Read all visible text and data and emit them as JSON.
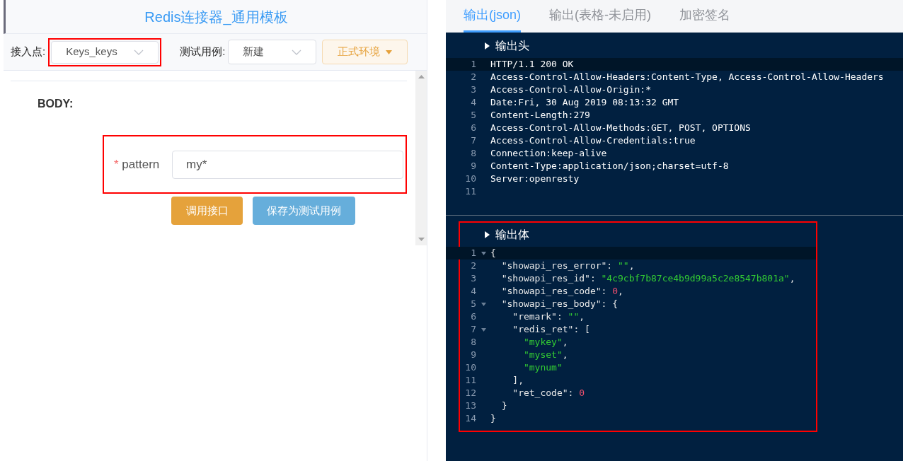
{
  "left": {
    "title": "Redis连接器_通用模板",
    "toolbar": {
      "endpoint_label": "接入点:",
      "endpoint_value": "Keys_keys",
      "testcase_label": "测试用例:",
      "testcase_value": "新建",
      "env_button": "正式环境"
    },
    "body_label": "BODY:",
    "field": {
      "required_mark": "*",
      "label": "pattern",
      "value": "my*"
    },
    "buttons": [
      {
        "label": "调用接口",
        "kind": "primary"
      },
      {
        "label": "保存为测试用例",
        "kind": "secondary"
      }
    ]
  },
  "right": {
    "tabs": [
      {
        "label": "输出(json)",
        "selected": true
      },
      {
        "label": "输出(表格-未启用)",
        "selected": false
      },
      {
        "label": "加密签名",
        "selected": false
      }
    ],
    "sections": [
      {
        "title": "输出头",
        "lines": [
          {
            "number": "1",
            "active": true,
            "tokens": [
              {
                "kind": "plain",
                "text": "HTTP/1.1 200 OK"
              }
            ]
          },
          {
            "number": "2",
            "tokens": [
              {
                "kind": "plain",
                "text": "Access-Control-Allow-Headers:Content-Type, Access-Control-Allow-Headers"
              }
            ]
          },
          {
            "number": "3",
            "tokens": [
              {
                "kind": "plain",
                "text": "Access-Control-Allow-Origin:*"
              }
            ]
          },
          {
            "number": "4",
            "tokens": [
              {
                "kind": "plain",
                "text": "Date:Fri, 30 Aug 2019 08:13:32 GMT"
              }
            ]
          },
          {
            "number": "5",
            "tokens": [
              {
                "kind": "plain",
                "text": "Content-Length:279"
              }
            ]
          },
          {
            "number": "6",
            "tokens": [
              {
                "kind": "plain",
                "text": "Access-Control-Allow-Methods:GET, POST, OPTIONS"
              }
            ]
          },
          {
            "number": "7",
            "tokens": [
              {
                "kind": "plain",
                "text": "Access-Control-Allow-Credentials:true"
              }
            ]
          },
          {
            "number": "8",
            "tokens": [
              {
                "kind": "plain",
                "text": "Connection:keep-alive"
              }
            ]
          },
          {
            "number": "9",
            "tokens": [
              {
                "kind": "plain",
                "text": "Content-Type:application/json;charset=utf-8"
              }
            ]
          },
          {
            "number": "10",
            "tokens": [
              {
                "kind": "plain",
                "text": "Server:openresty"
              }
            ]
          },
          {
            "number": "11"
          }
        ]
      },
      {
        "title": "输出体",
        "highlighted": true,
        "lines": [
          {
            "number": "1",
            "active": true,
            "fold": true,
            "tokens": [
              {
                "kind": "punct",
                "text": "{"
              }
            ]
          },
          {
            "number": "2",
            "tokens": [
              {
                "kind": "key",
                "text": "  \"showapi_res_error\": "
              },
              {
                "kind": "string",
                "text": "\"\""
              },
              {
                "kind": "punct",
                "text": ","
              }
            ]
          },
          {
            "number": "3",
            "tokens": [
              {
                "kind": "key",
                "text": "  \"showapi_res_id\": "
              },
              {
                "kind": "string",
                "text": "\"4c9cbf7b87ce4b9d99a5c2e8547b801a\""
              },
              {
                "kind": "punct",
                "text": ","
              }
            ]
          },
          {
            "number": "4",
            "tokens": [
              {
                "kind": "key",
                "text": "  \"showapi_res_code\": "
              },
              {
                "kind": "number",
                "text": "0"
              },
              {
                "kind": "punct",
                "text": ","
              }
            ]
          },
          {
            "number": "5",
            "fold": true,
            "tokens": [
              {
                "kind": "key",
                "text": "  \"showapi_res_body\": "
              },
              {
                "kind": "punct",
                "text": "{"
              }
            ]
          },
          {
            "number": "6",
            "tokens": [
              {
                "kind": "key",
                "text": "    \"remark\": "
              },
              {
                "kind": "string",
                "text": "\"\""
              },
              {
                "kind": "punct",
                "text": ","
              }
            ]
          },
          {
            "number": "7",
            "fold": true,
            "tokens": [
              {
                "kind": "key",
                "text": "    \"redis_ret\": "
              },
              {
                "kind": "punct",
                "text": "["
              }
            ]
          },
          {
            "number": "8",
            "tokens": [
              {
                "kind": "string",
                "text": "      \"mykey\""
              },
              {
                "kind": "punct",
                "text": ","
              }
            ]
          },
          {
            "number": "9",
            "tokens": [
              {
                "kind": "string",
                "text": "      \"myset\""
              },
              {
                "kind": "punct",
                "text": ","
              }
            ]
          },
          {
            "number": "10",
            "tokens": [
              {
                "kind": "string",
                "text": "      \"mynum\""
              }
            ]
          },
          {
            "number": "11",
            "tokens": [
              {
                "kind": "punct",
                "text": "    ],"
              }
            ]
          },
          {
            "number": "12",
            "tokens": [
              {
                "kind": "key",
                "text": "    \"ret_code\": "
              },
              {
                "kind": "number",
                "text": "0"
              }
            ]
          },
          {
            "number": "13",
            "tokens": [
              {
                "kind": "punct",
                "text": "  }"
              }
            ]
          },
          {
            "number": "14",
            "tokens": [
              {
                "kind": "punct",
                "text": "}"
              }
            ]
          }
        ]
      }
    ]
  }
}
